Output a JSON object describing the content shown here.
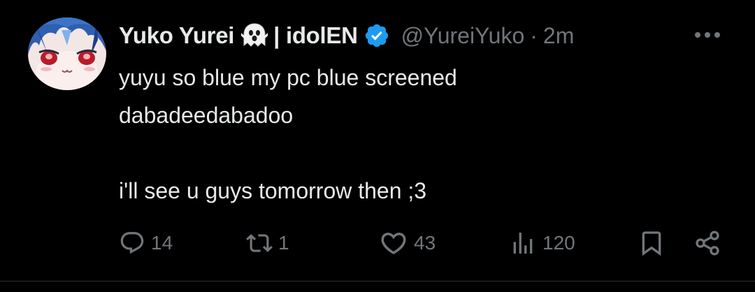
{
  "tweet": {
    "author": {
      "display_name": "Yuko Yurei",
      "name_suffix": "| idolEN",
      "handle": "@YureiYuko",
      "separator": "·",
      "time": "2m",
      "verified": true,
      "avatar_icon": "anime-avatar-icon"
    },
    "text_lines": [
      "yuyu so blue my pc blue screened",
      "dabadeedabadoo",
      "",
      "i'll see u guys tomorrow then ;3"
    ],
    "actions": {
      "reply_count": "14",
      "repost_count": "1",
      "like_count": "43",
      "views_count": "120"
    }
  },
  "colors": {
    "background": "#000000",
    "primary_text": "#e7e9ea",
    "secondary_text": "#71767b",
    "verified_blue": "#1d9bf0",
    "divider": "#2f3336"
  },
  "icons": {
    "name_emoji": "ghost-icon",
    "verified": "verified-badge-icon",
    "more": "more-horizontal-icon",
    "reply": "reply-icon",
    "repost": "repost-icon",
    "like": "heart-icon",
    "views": "views-icon",
    "bookmark": "bookmark-icon",
    "share": "share-icon"
  }
}
